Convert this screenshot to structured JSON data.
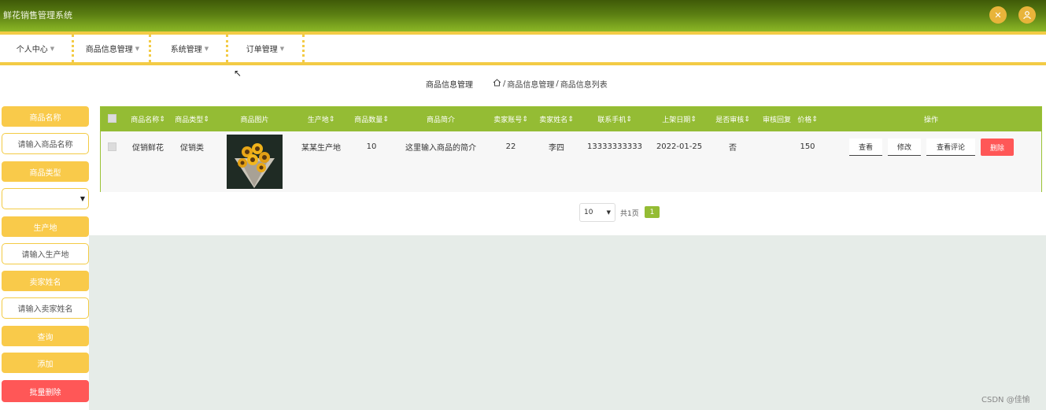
{
  "app": {
    "title": "鲜花销售管理系统"
  },
  "nav": [
    "个人中心",
    "商品信息管理",
    "系统管理",
    "订单管理"
  ],
  "breadcrumb": {
    "page_title": "商品信息管理",
    "path": [
      "商品信息管理",
      "商品信息列表"
    ],
    "separator": "/"
  },
  "sidebar": {
    "name_label": "商品名称",
    "name_placeholder": "请输入商品名称",
    "type_label": "商品类型",
    "type_value": "",
    "origin_label": "生产地",
    "origin_placeholder": "请输入生产地",
    "seller_label": "卖家姓名",
    "seller_placeholder": "请输入卖家姓名",
    "search_btn": "查询",
    "add_btn": "添加",
    "batch_delete_btn": "批量删除"
  },
  "table": {
    "headers": [
      "商品名称",
      "商品类型",
      "商品图片",
      "生产地",
      "商品数量",
      "商品简介",
      "卖家账号",
      "卖家姓名",
      "联系手机",
      "上架日期",
      "是否审核",
      "审核回复",
      "价格",
      "操作"
    ],
    "sortable_marker": "⇕",
    "rows": [
      {
        "name": "促销鲜花",
        "type": "促销类",
        "origin": "某某生产地",
        "quantity": "10",
        "intro": "这里输入商品的简介",
        "seller_account": "22",
        "seller_name": "李四",
        "phone": "13333333333",
        "date": "2022-01-25",
        "audited": "否",
        "reply": "",
        "price": "150"
      }
    ],
    "actions": [
      "查看",
      "修改",
      "查看评论",
      "删除"
    ]
  },
  "pagination": {
    "page_size": "10",
    "total_label": "共1页",
    "current_page": "1"
  },
  "watermark": "CSDN @佳愉",
  "colors": {
    "header": "#5a7e12",
    "accent_gold": "#f3cb45",
    "table_head": "#94bc34",
    "danger": "#ff5757",
    "button_yellow": "#f9ca4a"
  },
  "icons": {
    "fullscreen": "fullscreen-icon",
    "user": "user-icon",
    "home": "home-icon",
    "cursor": "mouse-cursor-icon"
  }
}
